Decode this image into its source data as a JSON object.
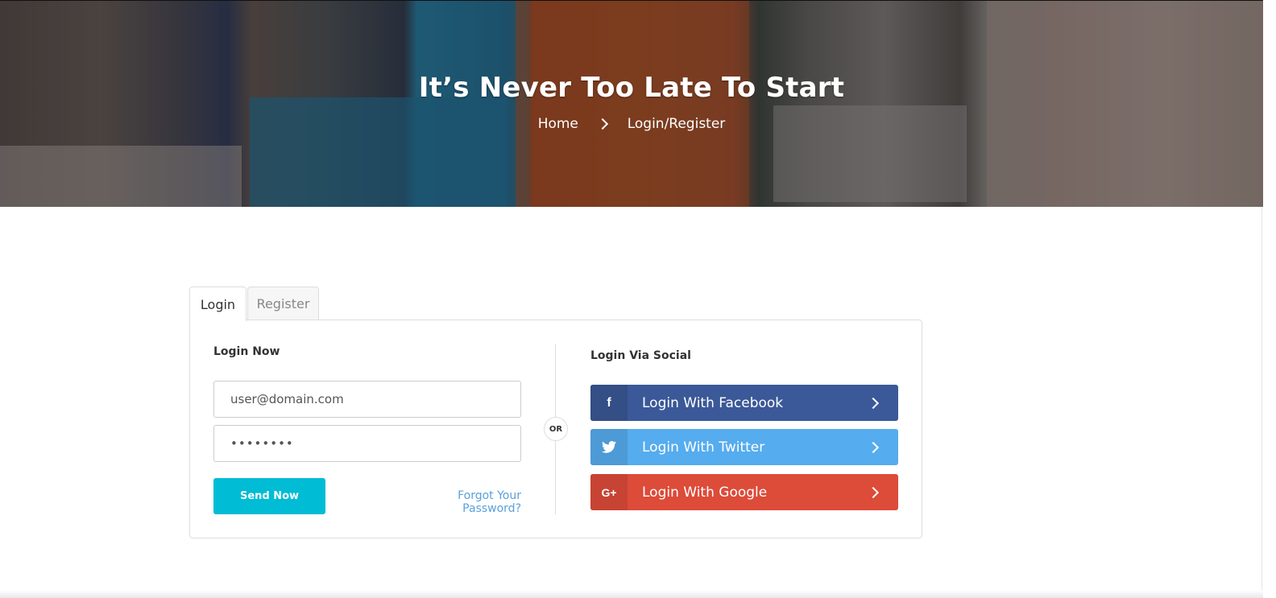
{
  "hero": {
    "title": "It’s Never Too Late To Start",
    "breadcrumb": {
      "home": "Home",
      "current": "Login/Register"
    }
  },
  "tabs": [
    {
      "label": "Login",
      "active": true
    },
    {
      "label": "Register",
      "active": false
    }
  ],
  "login": {
    "heading": "Login Now",
    "email_value": "user@domain.com",
    "password_value": "••••••••",
    "submit_label": "Send Now",
    "forgot_label": "Forgot Your Password?"
  },
  "divider_label": "OR",
  "social": {
    "heading": "Login Via Social",
    "buttons": [
      {
        "label": "Login With Facebook",
        "icon": "facebook-icon",
        "icon_glyph": "f",
        "color": "#3b5998"
      },
      {
        "label": "Login With Twitter",
        "icon": "twitter-icon",
        "icon_glyph": "🐦",
        "color": "#55acee"
      },
      {
        "label": "Login With Google",
        "icon": "google-plus-icon",
        "icon_glyph": "G+",
        "color": "#dd4b39"
      }
    ]
  },
  "colors": {
    "accent": "#00bcd4",
    "link": "#5aa0dc"
  }
}
